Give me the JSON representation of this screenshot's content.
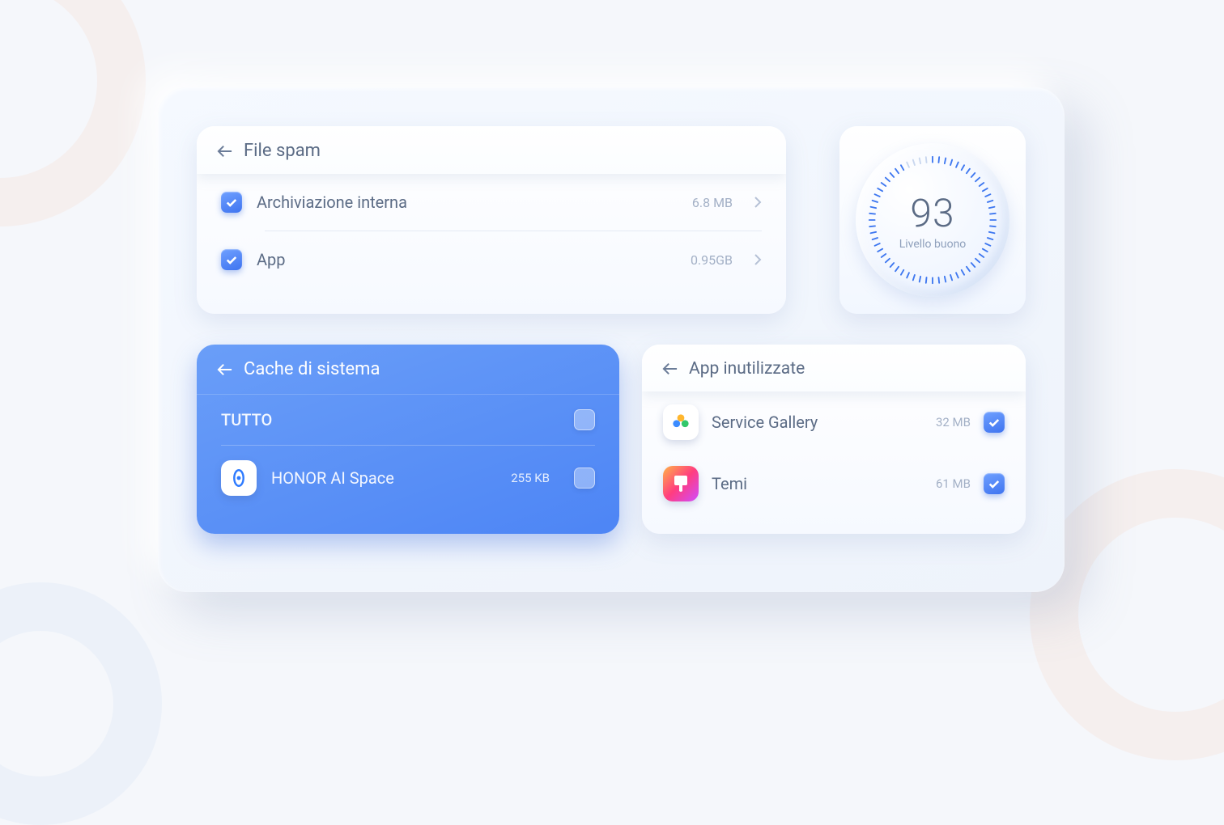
{
  "file_spam": {
    "title": "File spam",
    "items": [
      {
        "label": "Archiviazione interna",
        "size": "6.8 MB",
        "checked": true
      },
      {
        "label": "App",
        "size": "0.95GB",
        "checked": true
      }
    ]
  },
  "score": {
    "value": "93",
    "label": "Livello buono",
    "percent": 93
  },
  "cache": {
    "title": "Cache di sistema",
    "all_label": "TUTTO",
    "items": [
      {
        "label": "HONOR AI Space",
        "size": "255 KB",
        "checked": false
      }
    ]
  },
  "unused": {
    "title": "App inutilizzate",
    "items": [
      {
        "label": "Service Gallery",
        "size": "32 MB",
        "checked": true
      },
      {
        "label": "Temi",
        "size": "61 MB",
        "checked": true
      }
    ]
  }
}
